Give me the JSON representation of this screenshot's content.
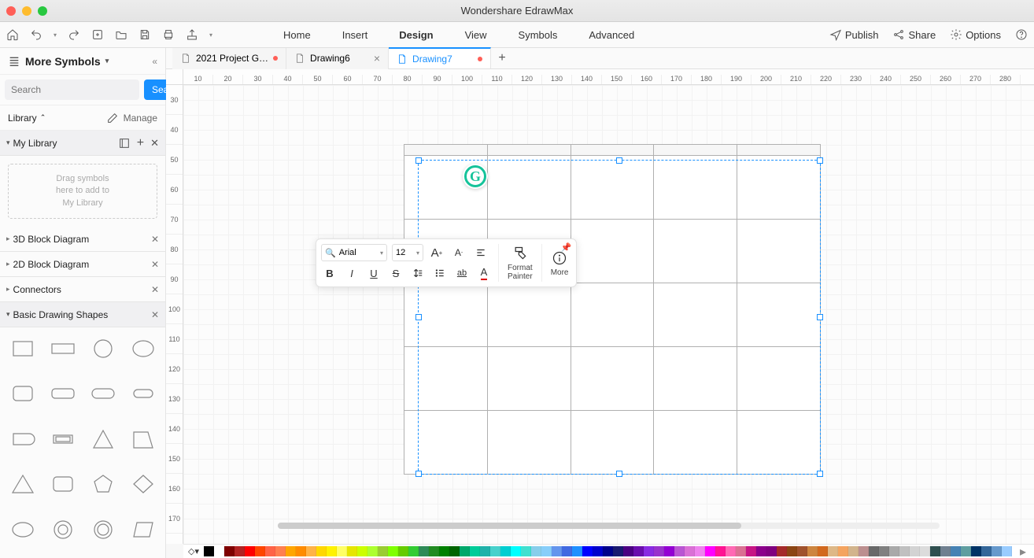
{
  "app": {
    "title": "Wondershare EdrawMax"
  },
  "menus": [
    "Home",
    "Insert",
    "Design",
    "View",
    "Symbols",
    "Advanced"
  ],
  "active_menu": "Design",
  "right_actions": {
    "publish": "Publish",
    "share": "Share",
    "options": "Options"
  },
  "sidebar": {
    "title": "More Symbols",
    "search_placeholder": "Search",
    "search_button": "Search",
    "library_label": "Library",
    "manage_label": "Manage",
    "mylibrary": "My Library",
    "dropzone": "Drag symbols\nhere to add to\nMy Library",
    "cats": [
      {
        "name": "3D Block Diagram",
        "open": false
      },
      {
        "name": "2D Block Diagram",
        "open": false
      },
      {
        "name": "Connectors",
        "open": false
      },
      {
        "name": "Basic Drawing Shapes",
        "open": true
      }
    ]
  },
  "tabs": [
    {
      "label": "2021 Project G…",
      "active": false,
      "dirty": true,
      "close": false
    },
    {
      "label": "Drawing6",
      "active": false,
      "dirty": false,
      "close": true
    },
    {
      "label": "Drawing7",
      "active": true,
      "dirty": true,
      "close": false
    }
  ],
  "ruler_h": [
    "10",
    "20",
    "30",
    "40",
    "50",
    "60",
    "70",
    "80",
    "90",
    "100",
    "110",
    "120",
    "130",
    "140",
    "150",
    "160",
    "170",
    "180",
    "190",
    "200",
    "210",
    "220",
    "230",
    "240",
    "250",
    "260",
    "270",
    "280"
  ],
  "ruler_v": [
    "30",
    "40",
    "50",
    "60",
    "70",
    "80",
    "90",
    "100",
    "110",
    "120",
    "130",
    "140",
    "150",
    "160",
    "170"
  ],
  "float_toolbar": {
    "font": "Arial",
    "size": "12",
    "format_painter": "Format\nPainter",
    "more": "More"
  },
  "colors": [
    "#000000",
    "#ffffff",
    "#7f0000",
    "#b22222",
    "#ff0000",
    "#ff4500",
    "#ff6347",
    "#ff7f50",
    "#ffa500",
    "#ff8c00",
    "#ffb347",
    "#ffd700",
    "#fff200",
    "#ffff66",
    "#e6e600",
    "#ccff00",
    "#adff2f",
    "#9acd32",
    "#7fff00",
    "#66cc00",
    "#33cc33",
    "#2e8b57",
    "#228b22",
    "#008000",
    "#006400",
    "#00a86b",
    "#00cc99",
    "#20b2aa",
    "#48d1cc",
    "#00ced1",
    "#00ffff",
    "#40e0d0",
    "#87ceeb",
    "#87cefa",
    "#6495ed",
    "#4169e1",
    "#1e90ff",
    "#0000ff",
    "#0000cd",
    "#00008b",
    "#191970",
    "#4b0082",
    "#6a0dad",
    "#8a2be2",
    "#9932cc",
    "#9400d3",
    "#ba55d3",
    "#da70d6",
    "#ee82ee",
    "#ff00ff",
    "#ff1493",
    "#ff69b4",
    "#db7093",
    "#c71585",
    "#8b008b",
    "#800080",
    "#a52a2a",
    "#8b4513",
    "#a0522d",
    "#cd853f",
    "#d2691e",
    "#deb887",
    "#f4a460",
    "#d2b48c",
    "#bc8f8f",
    "#696969",
    "#808080",
    "#a9a9a9",
    "#c0c0c0",
    "#d3d3d3",
    "#dcdcdc",
    "#2f4f4f",
    "#708090",
    "#4682b4",
    "#5f9ea0",
    "#003366",
    "#336699",
    "#6699cc",
    "#99ccff"
  ]
}
